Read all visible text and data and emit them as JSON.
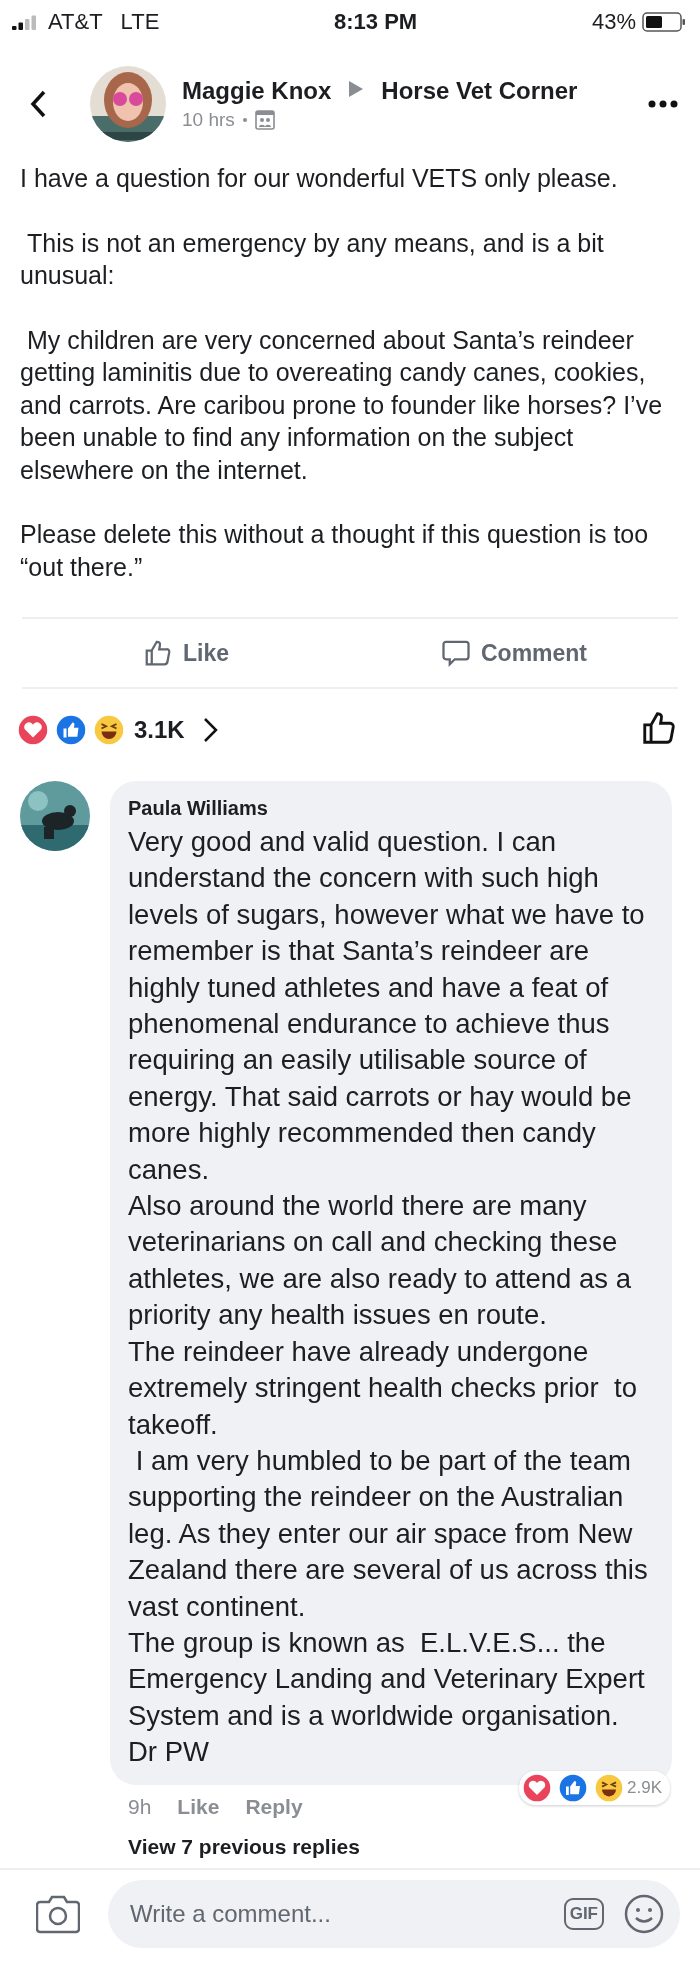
{
  "status_bar": {
    "carrier": "AT&T",
    "network": "LTE",
    "time": "8:13 PM",
    "battery": "43%"
  },
  "post": {
    "author": "Maggie Knox",
    "group": "Horse Vet Corner",
    "time": "10 hrs",
    "paragraphs": [
      "I have a question for our wonderful VETS only please.",
      " This is not an emergency by any means, and is a bit unusual:",
      " My children are very concerned about Santa’s reindeer getting laminitis due to overeating candy canes, cookies, and carrots. Are caribou prone to founder like horses? I’ve been unable to find any information on the subject elsewhere on the internet.",
      "Please delete this without a thought if this question is too “out there.”"
    ],
    "actions": [
      {
        "kind": "like",
        "label": "Like"
      },
      {
        "kind": "comment",
        "label": "Comment"
      }
    ]
  },
  "reactions": {
    "count": "3.1K"
  },
  "comment": {
    "author": "Paula Williams",
    "paragraphs": [
      "Very good and valid question. I can understand the concern with such high levels of sugars, however what we have to remember is that Santa’s reindeer are highly tuned athletes and have a feat of phenomenal endurance to achieve thus requiring an easily utilisable source of energy. That said carrots or hay would be more highly recommended then candy canes.",
      "Also around the world there are many veterinarians on call and checking these athletes, we are also ready to attend as a priority any health issues en route.",
      "The reindeer have already undergone extremely stringent health checks prior  to takeoff.",
      " I am very humbled to be part of the team supporting the reindeer on the Australian leg. As they enter our air space from New Zealand there are several of us across this vast continent.",
      "The group is known as  E.L.V.E.S... the Emergency Landing and Veterinary Expert System and is a worldwide organisation.",
      "Dr PW"
    ],
    "time": "9h",
    "actions": [
      "Like",
      "Reply"
    ],
    "reaction_count": "2.9K"
  },
  "view_replies": "View 7 previous replies",
  "composer": {
    "placeholder": "Write a comment...",
    "gif": "GIF"
  }
}
